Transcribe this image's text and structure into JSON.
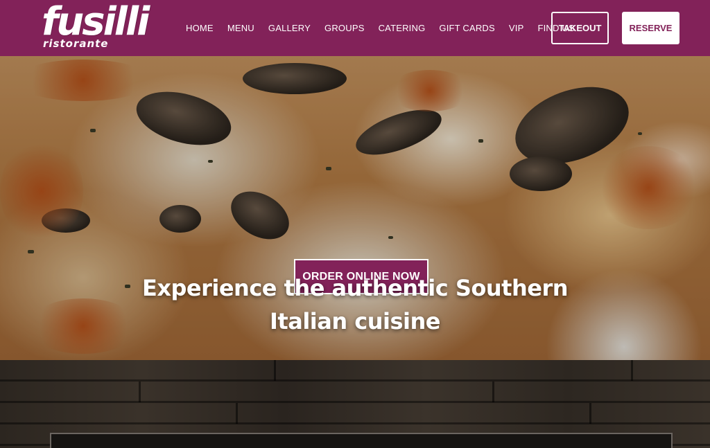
{
  "brand": {
    "logo_main": "fusilli",
    "logo_sub": "ristorante"
  },
  "nav": {
    "items": [
      "HOME",
      "MENU",
      "GALLERY",
      "GROUPS",
      "CATERING",
      "GIFT CARDS",
      "VIP",
      "FIND US"
    ]
  },
  "header_buttons": {
    "takeout": "TAKEOUT",
    "reserve": "RESERVE"
  },
  "hero": {
    "cta": "ORDER ONLINE NOW",
    "title_line1": "Experience the authentic Southern",
    "title_line2": "Italian cuisine"
  },
  "colors": {
    "brand": "#822259",
    "text_light": "#ffffff",
    "wood": "#2c2620"
  }
}
